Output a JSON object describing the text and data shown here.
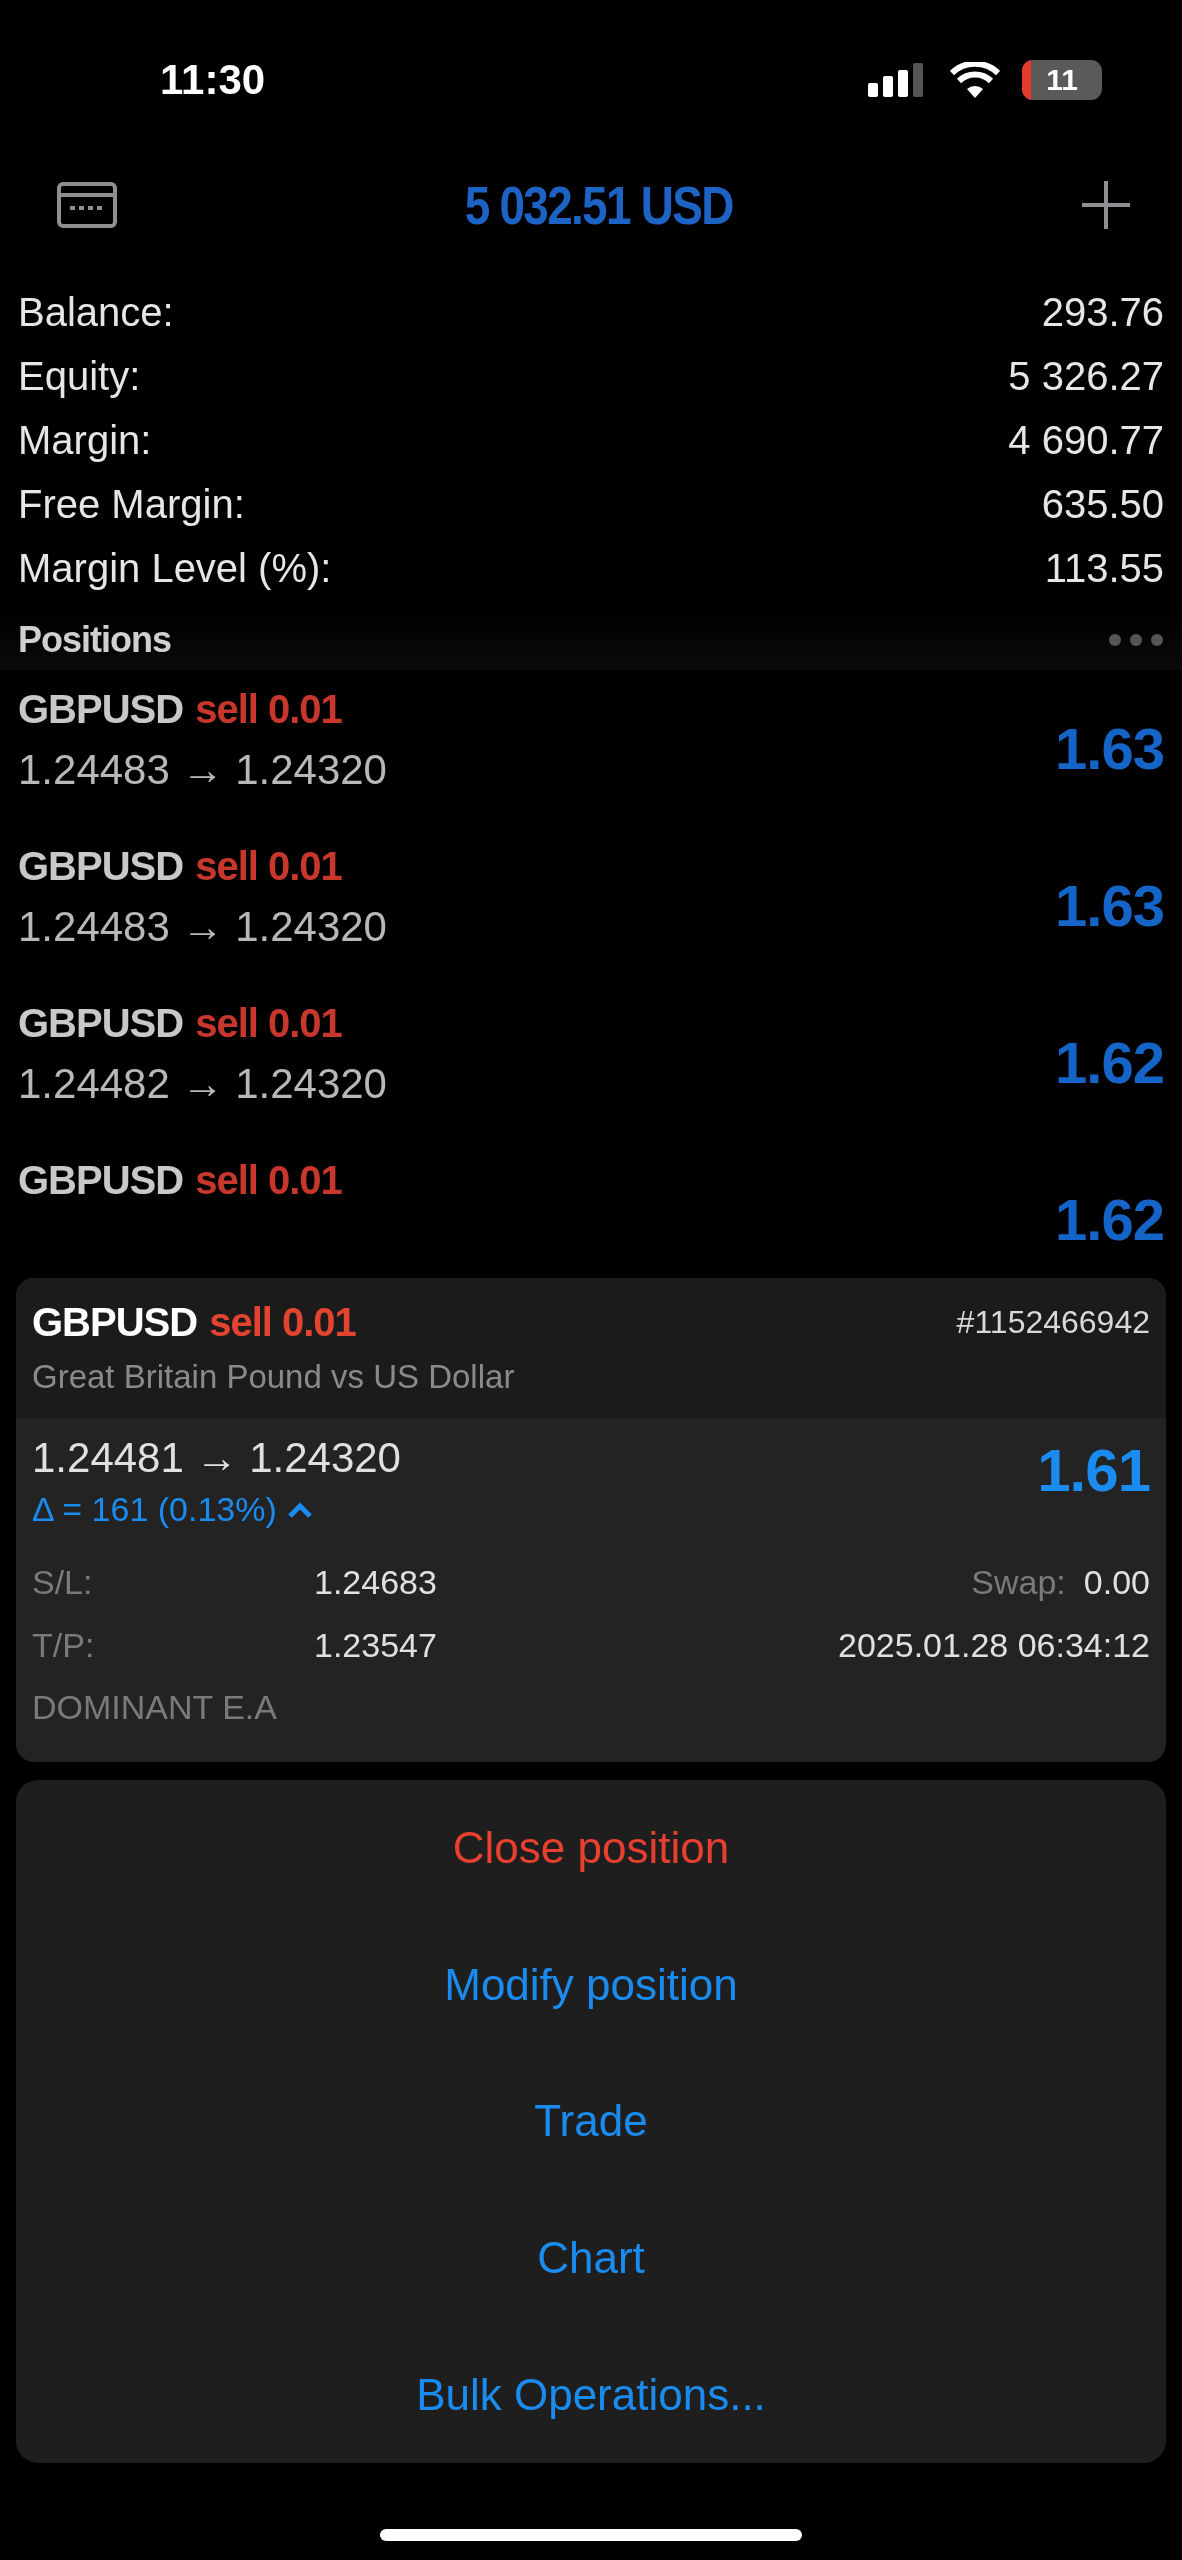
{
  "status_bar": {
    "time": "11:30",
    "battery": "11"
  },
  "header": {
    "title": "5 032.51 USD"
  },
  "account": [
    {
      "label": "Balance:",
      "value": "293.76"
    },
    {
      "label": "Equity:",
      "value": "5 326.27"
    },
    {
      "label": "Margin:",
      "value": "4 690.77"
    },
    {
      "label": "Free Margin:",
      "value": "635.50"
    },
    {
      "label": "Margin Level (%):",
      "value": "113.55"
    }
  ],
  "positions": {
    "title": "Positions",
    "items": [
      {
        "symbol": "GBPUSD",
        "order": "sell 0.01",
        "prices": "1.24483 → 1.24320",
        "profit": "1.63"
      },
      {
        "symbol": "GBPUSD",
        "order": "sell 0.01",
        "prices": "1.24483 → 1.24320",
        "profit": "1.63"
      },
      {
        "symbol": "GBPUSD",
        "order": "sell 0.01",
        "prices": "1.24482 → 1.24320",
        "profit": "1.62"
      },
      {
        "symbol": "GBPUSD",
        "order": "sell 0.01",
        "profit": "1.62"
      }
    ]
  },
  "detail": {
    "symbol": "GBPUSD",
    "order": "sell 0.01",
    "ticket": "#1152466942",
    "description": "Great Britain Pound vs US Dollar",
    "prices": "1.24481 → 1.24320",
    "delta": "Δ = 161 (0.13%)",
    "profit": "1.61",
    "sl_label": "S/L:",
    "sl": "1.24683",
    "swap_label": "Swap:",
    "swap": "0.00",
    "tp_label": "T/P:",
    "tp": "1.23547",
    "time": "2025.01.28 06:34:12",
    "comment": "DOMINANT E.A"
  },
  "actions": [
    {
      "label": "Close position",
      "kind": "destructive"
    },
    {
      "label": "Modify position",
      "kind": "default"
    },
    {
      "label": "Trade",
      "kind": "default"
    },
    {
      "label": "Chart",
      "kind": "default"
    },
    {
      "label": "Bulk Operations...",
      "kind": "default"
    }
  ]
}
